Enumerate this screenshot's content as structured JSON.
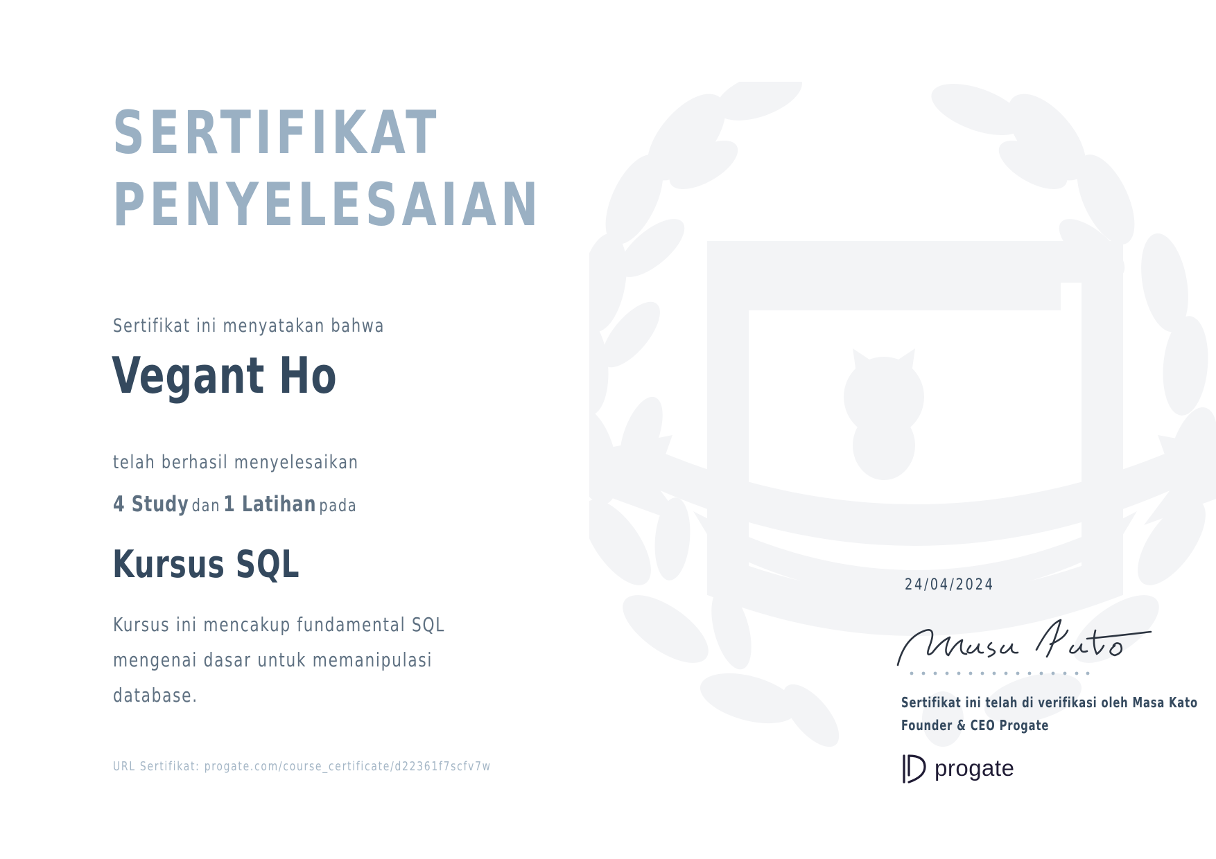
{
  "title": {
    "line1": "SERTIFIKAT",
    "line2": "PENYELESAIAN"
  },
  "intro": "Sertifikat ini menyatakan bahwa",
  "recipient_name": "Vegant Ho",
  "completed_text": "telah berhasil menyelesaikan",
  "stats": {
    "study": "4 Study",
    "and": "dan",
    "exercise": "1 Latihan",
    "on": "pada"
  },
  "course_name": "Kursus SQL",
  "description": {
    "line1": "Kursus ini mencakup fundamental SQL",
    "line2": "mengenai dasar untuk memanipulasi",
    "line3": "database."
  },
  "certificate_url": "URL Sertifikat: progate.com/course_certificate/d22361f7scfv7w",
  "date": "24/04/2024",
  "signature_name": "Masa Kato",
  "verification": {
    "line1": "Sertifikat ini telah di verifikasi oleh Masa Kato",
    "line2": "Founder & CEO Progate"
  },
  "logo_text": "progate",
  "colors": {
    "title": "#9ab0c3",
    "dark": "#34495e",
    "muted": "#5e7081",
    "light": "#a4b6c6",
    "watermark": "#f3f4f6"
  },
  "icons": {
    "watermark": "laurel-crest-icon",
    "logo": "progate-logo-icon"
  }
}
